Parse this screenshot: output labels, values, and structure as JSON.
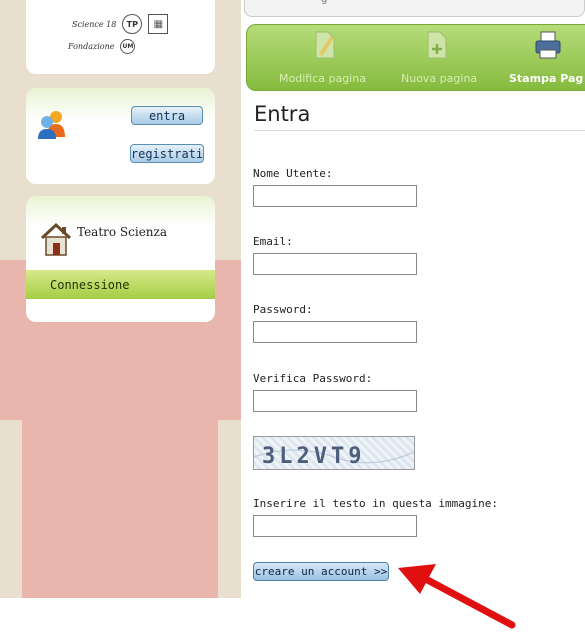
{
  "sidebar": {
    "logos": {
      "row1_text": "Science 18",
      "row1_circle": "TP",
      "row2_text": "Fondazione",
      "row2_circle": "UM"
    },
    "login": {
      "enter_label": "entra",
      "register_label": "registrati"
    },
    "nav": {
      "title": "Teatro Scienza",
      "active_item": "Connessione"
    }
  },
  "toolbar": {
    "edit_label": "Modifica pagina",
    "new_label": "Nuova pagina",
    "print_label": "Stampa Pag"
  },
  "form": {
    "heading": "Entra",
    "username_label": "Nome Utente:",
    "username_value": "",
    "email_label": "Email:",
    "email_value": "",
    "password_label": "Password:",
    "password_value": "",
    "verify_label": "Verifica Password:",
    "verify_value": "",
    "captcha_text": "3L2VT9",
    "captcha_prompt": "Inserire il testo in questa immagine:",
    "captcha_value": "",
    "submit_label": "creare un account >>"
  },
  "colors": {
    "toolbar_green": "#86bb3e",
    "nav_active_green": "#a5cc44",
    "annotation_arrow": "#e01010",
    "sidebar_pink": "#e8b6ad",
    "sidebar_beige": "#e8dfcf"
  },
  "icons": {
    "edit": "pencil-page-icon",
    "new": "add-page-icon",
    "print": "printer-icon",
    "users": "users-icon",
    "home": "house-icon"
  }
}
